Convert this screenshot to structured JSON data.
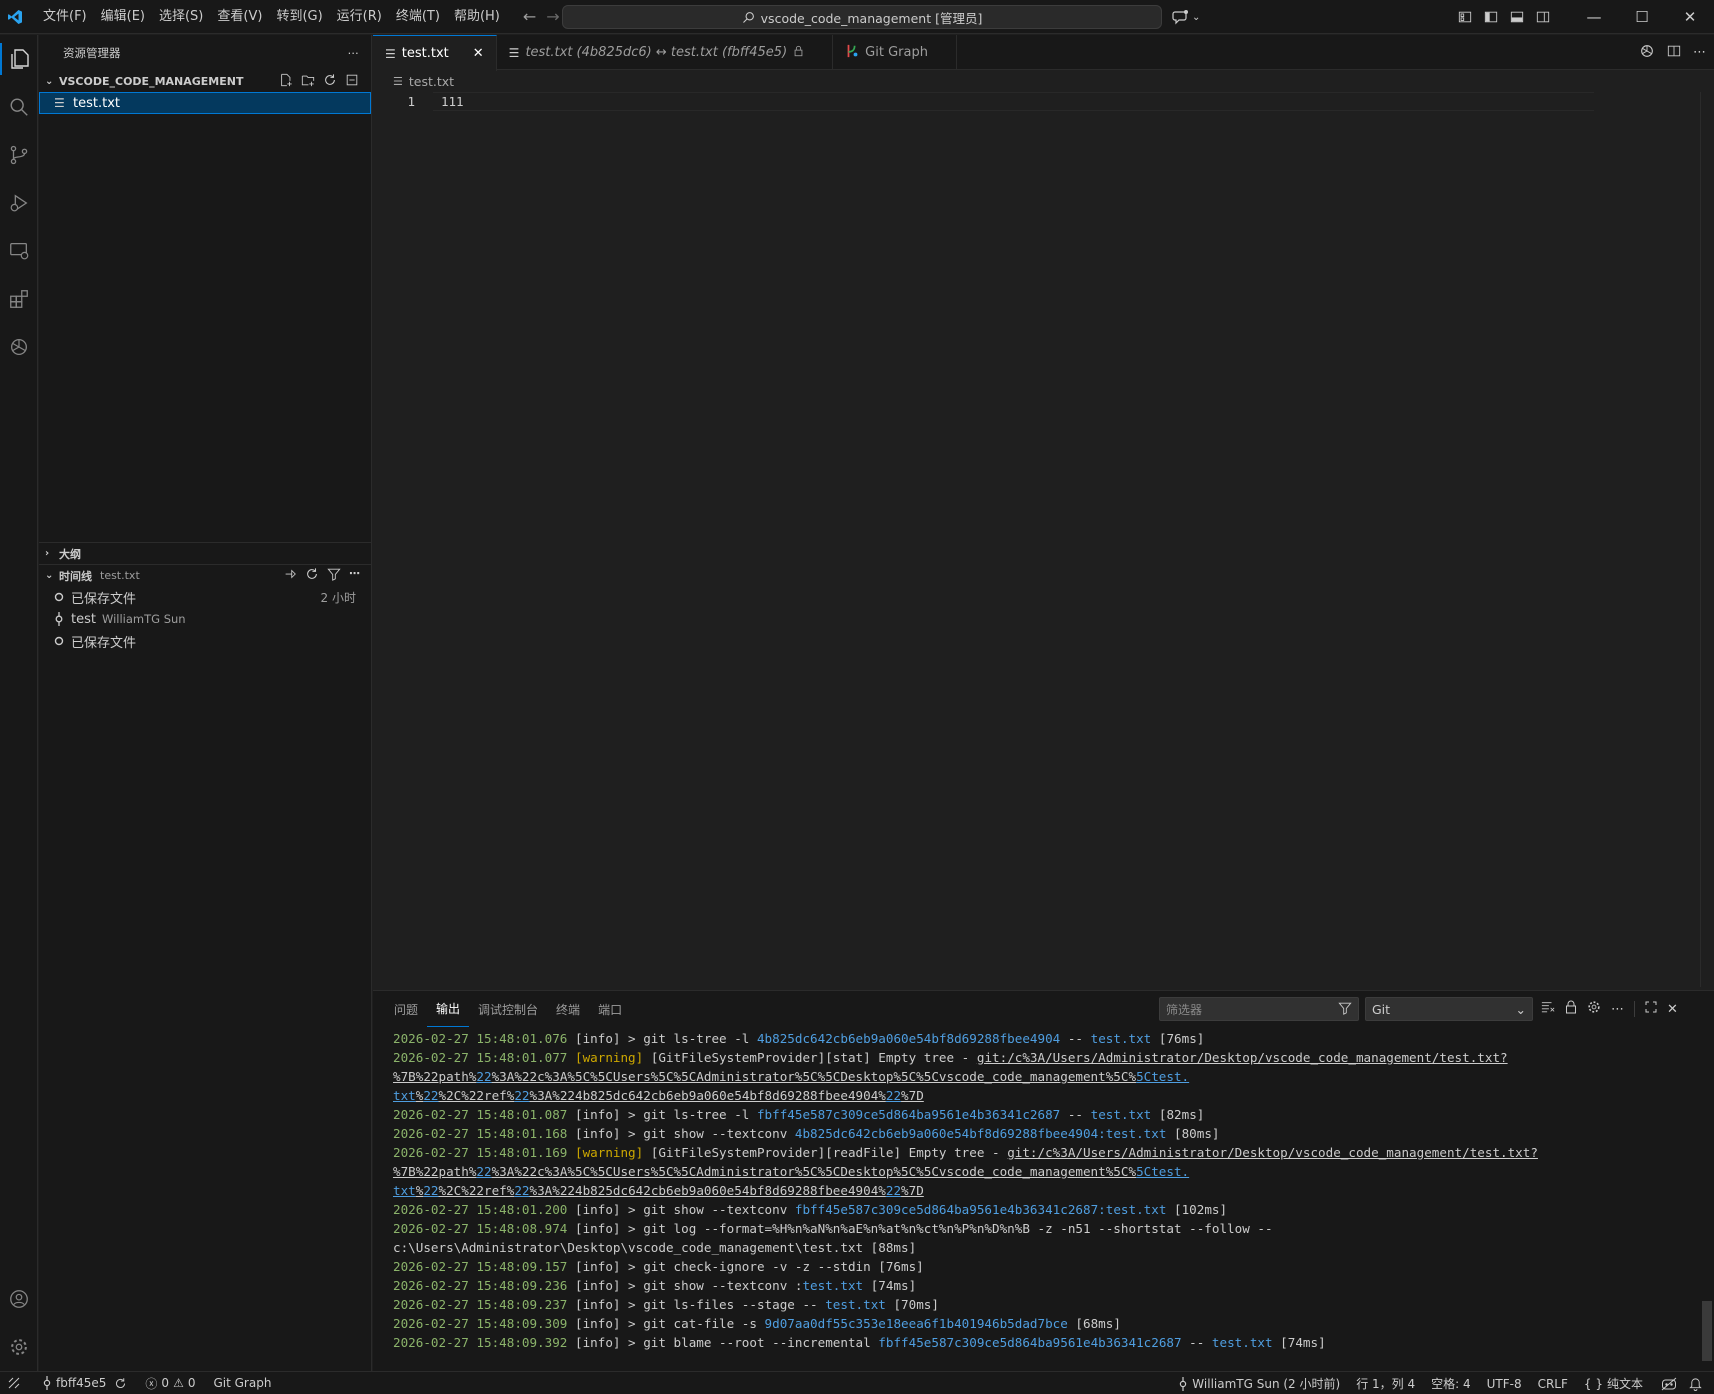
{
  "titlebar": {
    "menu": [
      "文件(F)",
      "编辑(E)",
      "选择(S)",
      "查看(V)",
      "转到(G)",
      "运行(R)",
      "终端(T)",
      "帮助(H)"
    ],
    "search_text": "vscode_code_management [管理员]"
  },
  "sidebar": {
    "title": "资源管理器",
    "folder_name": "VSCODE_CODE_MANAGEMENT",
    "files": [
      {
        "name": "test.txt"
      }
    ],
    "outline_label": "大纲",
    "timeline": {
      "label": "时间线",
      "file": "test.txt",
      "items": [
        {
          "title": "已保存文件",
          "sub": "",
          "time": "2 小时"
        },
        {
          "title": "test",
          "sub": "WilliamTG Sun",
          "time": ""
        },
        {
          "title": "已保存文件",
          "sub": "",
          "time": ""
        }
      ]
    }
  },
  "editor": {
    "tabs": [
      {
        "label": "test.txt",
        "active": true
      },
      {
        "label": "test.txt (4b825dc6) ↔ test.txt (fbff45e5)"
      },
      {
        "label": "Git Graph"
      }
    ],
    "breadcrumb": "test.txt",
    "lines": [
      {
        "num": "1",
        "text": "111"
      }
    ]
  },
  "panel": {
    "tabs": [
      "问题",
      "输出",
      "调试控制台",
      "终端",
      "端口"
    ],
    "active_tab": "输出",
    "filter_placeholder": "筛选器",
    "channel": "Git",
    "log": [
      [
        {
          "c": "ts",
          "t": "2026-02-27 15:48:01.076 "
        },
        {
          "c": "",
          "t": "[info] > git ls-tree -l "
        },
        {
          "c": "hash",
          "t": "4b825dc642cb6eb9a060e54bf8d69288fbee4904"
        },
        {
          "c": "",
          "t": " -- "
        },
        {
          "c": "hash",
          "t": "test.txt"
        },
        {
          "c": "",
          "t": " [76ms]"
        }
      ],
      [
        {
          "c": "ts",
          "t": "2026-02-27 15:48:01.077 "
        },
        {
          "c": "warn",
          "t": "[warning]"
        },
        {
          "c": "",
          "t": " [GitFileSystemProvider][stat] Empty tree - "
        },
        {
          "c": "link",
          "t": "git:/c%3A/Users/Administrator/Desktop/vscode_code_management/test.txt?"
        }
      ],
      [
        {
          "c": "link",
          "t": "%7B%22path%"
        },
        {
          "c": "link2",
          "t": "22"
        },
        {
          "c": "link",
          "t": "%3A%22c%3A%5C%5CUsers%5C%5CAdministrator%5C%5CDesktop%5C%5Cvscode_code_management%5C%"
        },
        {
          "c": "link2",
          "t": "5Ctest."
        }
      ],
      [
        {
          "c": "link2",
          "t": "txt"
        },
        {
          "c": "link",
          "t": "%"
        },
        {
          "c": "link2",
          "t": "22"
        },
        {
          "c": "link",
          "t": "%2C%22ref%"
        },
        {
          "c": "link2",
          "t": "22"
        },
        {
          "c": "link",
          "t": "%3A%224b825dc642cb6eb9a060e54bf8d69288fbee4904%"
        },
        {
          "c": "link2",
          "t": "22"
        },
        {
          "c": "link",
          "t": "%7D"
        }
      ],
      [
        {
          "c": "ts",
          "t": "2026-02-27 15:48:01.087 "
        },
        {
          "c": "",
          "t": "[info] > git ls-tree -l "
        },
        {
          "c": "hash",
          "t": "fbff45e587c309ce5d864ba9561e4b36341c2687"
        },
        {
          "c": "",
          "t": " -- "
        },
        {
          "c": "hash",
          "t": "test.txt"
        },
        {
          "c": "",
          "t": " [82ms]"
        }
      ],
      [
        {
          "c": "ts",
          "t": "2026-02-27 15:48:01.168 "
        },
        {
          "c": "",
          "t": "[info] > git show --textconv "
        },
        {
          "c": "hash",
          "t": "4b825dc642cb6eb9a060e54bf8d69288fbee4904:test.txt"
        },
        {
          "c": "",
          "t": " [80ms]"
        }
      ],
      [
        {
          "c": "ts",
          "t": "2026-02-27 15:48:01.169 "
        },
        {
          "c": "warn",
          "t": "[warning]"
        },
        {
          "c": "",
          "t": " [GitFileSystemProvider][readFile] Empty tree - "
        },
        {
          "c": "link",
          "t": "git:/c%3A/Users/Administrator/Desktop/vscode_code_management/test.txt?"
        }
      ],
      [
        {
          "c": "link",
          "t": "%7B%22path%"
        },
        {
          "c": "link2",
          "t": "22"
        },
        {
          "c": "link",
          "t": "%3A%22c%3A%5C%5CUsers%5C%5CAdministrator%5C%5CDesktop%5C%5Cvscode_code_management%5C%"
        },
        {
          "c": "link2",
          "t": "5Ctest."
        }
      ],
      [
        {
          "c": "link2",
          "t": "txt"
        },
        {
          "c": "link",
          "t": "%"
        },
        {
          "c": "link2",
          "t": "22"
        },
        {
          "c": "link",
          "t": "%2C%22ref%"
        },
        {
          "c": "link2",
          "t": "22"
        },
        {
          "c": "link",
          "t": "%3A%224b825dc642cb6eb9a060e54bf8d69288fbee4904%"
        },
        {
          "c": "link2",
          "t": "22"
        },
        {
          "c": "link",
          "t": "%7D"
        }
      ],
      [
        {
          "c": "ts",
          "t": "2026-02-27 15:48:01.200 "
        },
        {
          "c": "",
          "t": "[info] > git show --textconv "
        },
        {
          "c": "hash",
          "t": "fbff45e587c309ce5d864ba9561e4b36341c2687:test.txt"
        },
        {
          "c": "",
          "t": " [102ms]"
        }
      ],
      [
        {
          "c": "ts",
          "t": "2026-02-27 15:48:08.974 "
        },
        {
          "c": "",
          "t": "[info] > git log --format=%H%n%aN%n%aE%n%at%n%ct%n%P%n%D%n%B -z -n51 --shortstat --follow --"
        }
      ],
      [
        {
          "c": "",
          "t": "c:\\Users\\Administrator\\Desktop\\vscode_code_management\\test.txt [88ms]"
        }
      ],
      [
        {
          "c": "ts",
          "t": "2026-02-27 15:48:09.157 "
        },
        {
          "c": "",
          "t": "[info] > git check-ignore -v -z --stdin [76ms]"
        }
      ],
      [
        {
          "c": "ts",
          "t": "2026-02-27 15:48:09.236 "
        },
        {
          "c": "",
          "t": "[info] > git show --textconv :"
        },
        {
          "c": "hash",
          "t": "test.txt"
        },
        {
          "c": "",
          "t": " [74ms]"
        }
      ],
      [
        {
          "c": "ts",
          "t": "2026-02-27 15:48:09.237 "
        },
        {
          "c": "",
          "t": "[info] > git ls-files --stage -- "
        },
        {
          "c": "hash",
          "t": "test.txt"
        },
        {
          "c": "",
          "t": " [70ms]"
        }
      ],
      [
        {
          "c": "ts",
          "t": "2026-02-27 15:48:09.309 "
        },
        {
          "c": "",
          "t": "[info] > git cat-file -s "
        },
        {
          "c": "hash",
          "t": "9d07aa0df55c353e18eea6f1b401946b5dad7bce"
        },
        {
          "c": "",
          "t": " [68ms]"
        }
      ],
      [
        {
          "c": "ts",
          "t": "2026-02-27 15:48:09.392 "
        },
        {
          "c": "",
          "t": "[info] > git blame --root --incremental "
        },
        {
          "c": "hash",
          "t": "fbff45e587c309ce5d864ba9561e4b36341c2687"
        },
        {
          "c": "",
          "t": " -- "
        },
        {
          "c": "hash",
          "t": "test.txt"
        },
        {
          "c": "",
          "t": " [74ms]"
        }
      ]
    ]
  },
  "statusbar": {
    "branch": "fbff45e5",
    "errors": "0",
    "warnings": "0",
    "git_graph": "Git Graph",
    "blame": "WilliamTG Sun (2 小时前)",
    "position": "行 1，列 4",
    "spaces": "空格: 4",
    "encoding": "UTF-8",
    "eol": "CRLF",
    "language": "纯文本"
  },
  "colors": {
    "accent": "#0078d4",
    "selection": "#04395e",
    "timestamp": "#8bb36a",
    "warning": "#cca700",
    "hash": "#4f9ee0"
  }
}
